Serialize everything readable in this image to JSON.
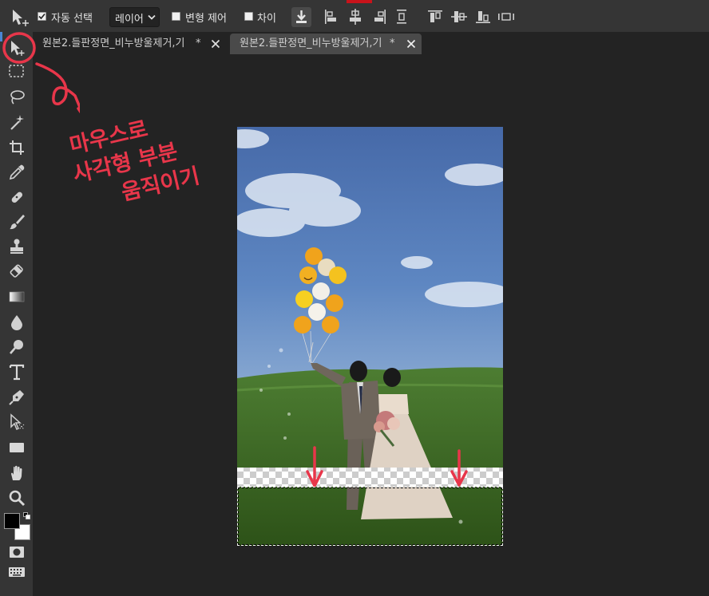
{
  "options_bar": {
    "auto_select_label": "자동 선택",
    "auto_select_checked": true,
    "layer_select_value": "레이어",
    "transform_controls_label": "변형 제어",
    "transform_controls_checked": false,
    "distance_label": "차이",
    "distance_checked": false
  },
  "tabs": [
    {
      "title": "원본2.들판정면_비누방울제거,기",
      "modified": "*",
      "active": false
    },
    {
      "title": "원본2.들판정면_비누방울제거,기",
      "modified": "*",
      "active": true
    }
  ],
  "tools": [
    "move-tool",
    "marquee-tool",
    "lasso-tool",
    "magic-wand-tool",
    "crop-tool",
    "eyedropper-tool",
    "healing-brush-tool",
    "brush-tool",
    "clone-stamp-tool",
    "eraser-tool",
    "gradient-tool",
    "blur-tool",
    "dodge-tool",
    "type-tool",
    "pen-tool",
    "path-selection-tool",
    "rectangle-tool",
    "hand-tool",
    "zoom-tool"
  ],
  "colors": {
    "foreground": "#000000",
    "background": "#ffffff",
    "annotation": "#e8364a",
    "sky_top": "#4a6aa8",
    "grass": "#3f6e2a"
  },
  "annotation": {
    "lines": [
      "마우스로",
      "사각형 부분",
      "움직이기"
    ]
  }
}
